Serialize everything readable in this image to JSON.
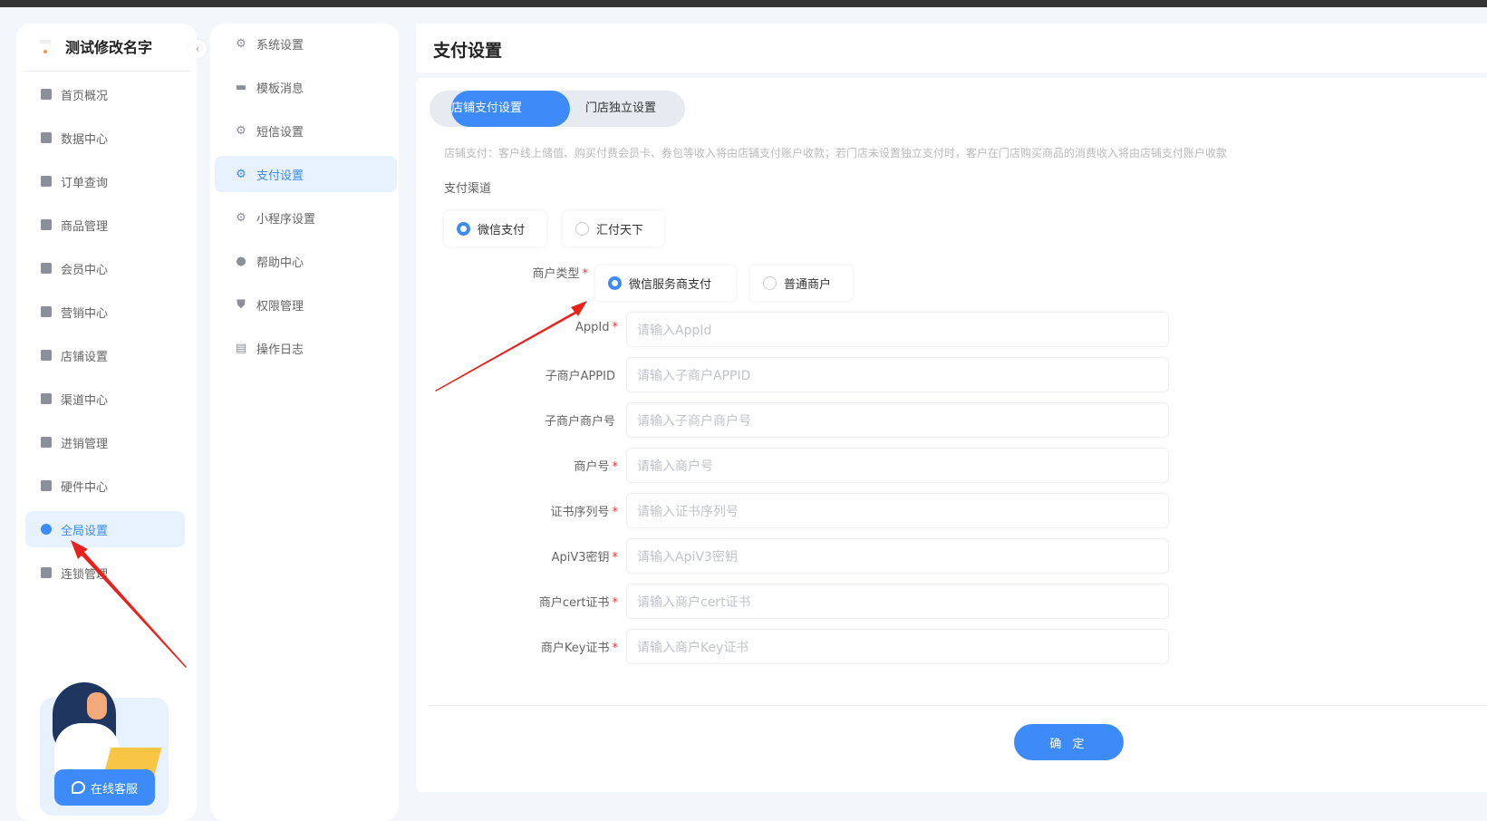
{
  "brand": {
    "name": "测试修改名字"
  },
  "sidebar": {
    "items": [
      {
        "label": "首页概况",
        "icon": "grid-icon"
      },
      {
        "label": "数据中心",
        "icon": "bar-chart-icon"
      },
      {
        "label": "订单查询",
        "icon": "calendar-icon"
      },
      {
        "label": "商品管理",
        "icon": "bag-icon"
      },
      {
        "label": "会员中心",
        "icon": "crown-icon"
      },
      {
        "label": "营销中心",
        "icon": "hourglass-icon"
      },
      {
        "label": "店铺设置",
        "icon": "store-icon"
      },
      {
        "label": "渠道中心",
        "icon": "channel-icon"
      },
      {
        "label": "进销管理",
        "icon": "list-icon"
      },
      {
        "label": "硬件中心",
        "icon": "hardware-icon"
      },
      {
        "label": "全局设置",
        "icon": "gear-icon",
        "active": true
      },
      {
        "label": "连锁管理",
        "icon": "shield-icon"
      }
    ],
    "chat_button": "在线客服"
  },
  "submenu": {
    "items": [
      {
        "label": "系统设置",
        "icon": "gear-icon"
      },
      {
        "label": "模板消息",
        "icon": "message-icon"
      },
      {
        "label": "短信设置",
        "icon": "gear-icon"
      },
      {
        "label": "支付设置",
        "icon": "gear-icon",
        "active": true
      },
      {
        "label": "小程序设置",
        "icon": "gear-icon"
      },
      {
        "label": "帮助中心",
        "icon": "info-icon"
      },
      {
        "label": "权限管理",
        "icon": "shield-icon"
      },
      {
        "label": "操作日志",
        "icon": "log-icon"
      }
    ]
  },
  "page": {
    "title": "支付设置"
  },
  "tabs": [
    {
      "label": "店铺支付设置",
      "active": true
    },
    {
      "label": "门店独立设置"
    }
  ],
  "description": "店铺支付：客户线上储值、购买付费会员卡、券包等收入将由店铺支付账户收款；若门店未设置独立支付时，客户在门店购买商品的消费收入将由店铺支付账户收款",
  "channel": {
    "label": "支付渠道",
    "options": [
      {
        "label": "微信支付",
        "selected": true
      },
      {
        "label": "汇付天下",
        "selected": false
      }
    ]
  },
  "merchant_type": {
    "label": "商户类型",
    "options": [
      {
        "label": "微信服务商支付",
        "selected": true
      },
      {
        "label": "普通商户",
        "selected": false
      }
    ]
  },
  "fields": [
    {
      "label": "AppId",
      "required": "*",
      "placeholder": "请输入AppId",
      "value": ""
    },
    {
      "label": "子商户APPID",
      "required": "",
      "placeholder": "请输入子商户APPID",
      "value": ""
    },
    {
      "label": "子商户商户号",
      "required": "",
      "placeholder": "请输入子商户商户号",
      "value": ""
    },
    {
      "label": "商户号",
      "required": "*",
      "placeholder": "请输入商户号",
      "value": ""
    },
    {
      "label": "证书序列号",
      "required": "*",
      "placeholder": "请输入证书序列号",
      "value": ""
    },
    {
      "label": "ApiV3密钥",
      "required": "*",
      "placeholder": "请输入ApiV3密钥",
      "value": ""
    },
    {
      "label": "商户cert证书",
      "required": "*",
      "placeholder": "请输入商户cert证书",
      "value": ""
    },
    {
      "label": "商户Key证书",
      "required": "*",
      "placeholder": "请输入商户Key证书",
      "value": ""
    }
  ],
  "submit": "确 定",
  "colors": {
    "accent": "#3d8bf8",
    "annotation_arrow": "#e8211c",
    "required": "#e53935"
  }
}
